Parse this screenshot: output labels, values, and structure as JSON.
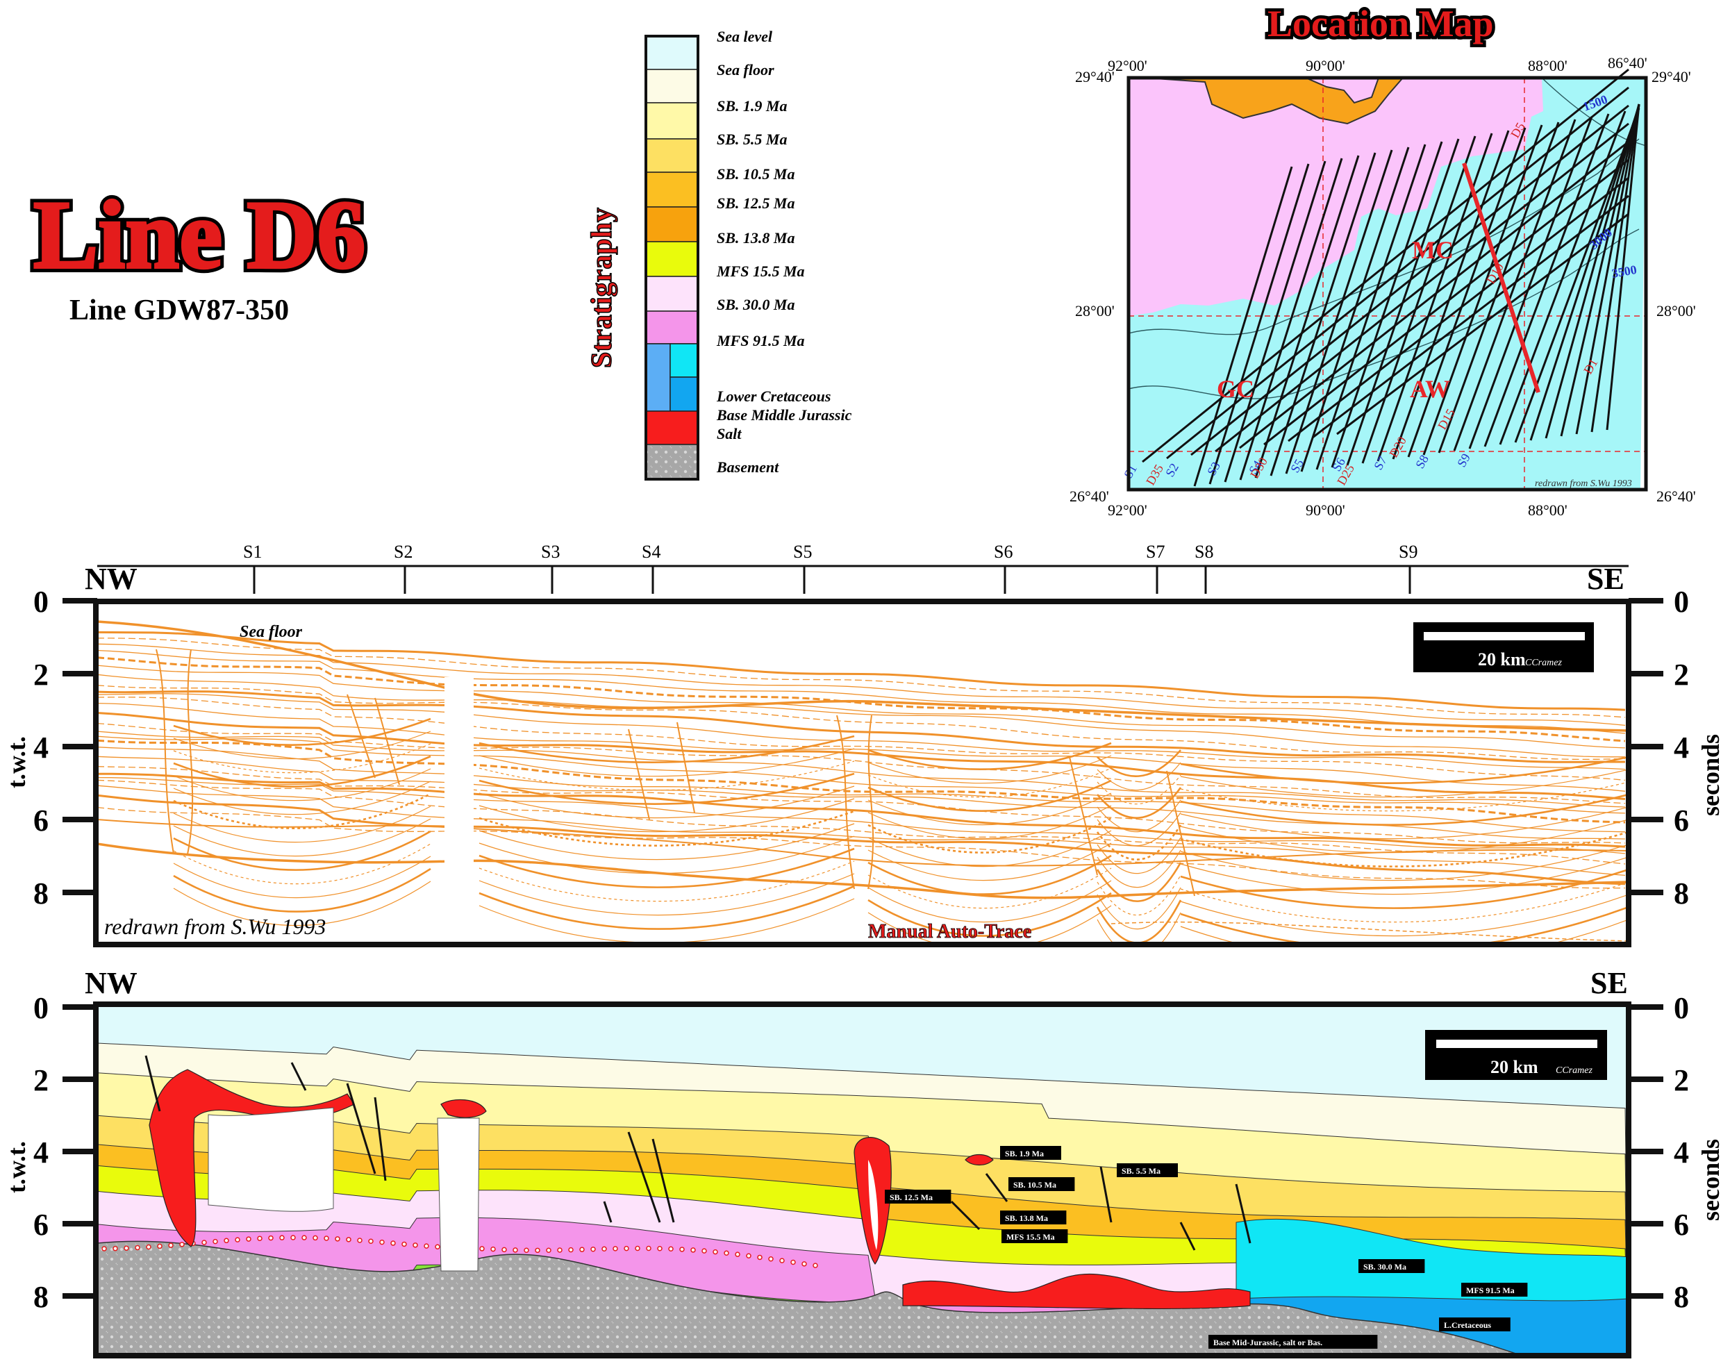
{
  "title": {
    "main": "Line D6",
    "sub": "Line GDW87-350"
  },
  "stratigraphy": {
    "heading": "Stratigraphy",
    "units": [
      {
        "label": "Sea level",
        "color": "#dffafc"
      },
      {
        "label": "Sea floor",
        "color": "#fdfbe6"
      },
      {
        "label": "SB. 1.9 Ma",
        "color": "#fff9a8"
      },
      {
        "label": "SB. 5.5 Ma",
        "color": "#fde062"
      },
      {
        "label": "SB. 10.5 Ma",
        "color": "#fbbf22"
      },
      {
        "label": "SB. 12.5 Ma",
        "color": "#f7a20d"
      },
      {
        "label": "SB. 13.8 Ma",
        "color": "#e9fb0c"
      },
      {
        "label": "MFS 15.5 Ma",
        "color": "#fde3fb"
      },
      {
        "label": "SB. 30.0 Ma",
        "color": "#f495ea"
      },
      {
        "label": "MFS 91.5 Ma",
        "color": "#86e23a"
      },
      {
        "label": "Lower Cretaceous",
        "color": "#5caef5"
      },
      {
        "label": "Base Middle Jurassic",
        "color": "#10e6f5"
      },
      {
        "label": "Salt",
        "color": "#f71d1d"
      },
      {
        "label": "Basement",
        "color": "#a8a8a8"
      }
    ]
  },
  "location_map": {
    "title": "Location Map",
    "corner_labels": {
      "top_left_lat": "29°40'",
      "top_right_lat": "29°40'",
      "bottom_left_lat": "26°40'",
      "bottom_right_lat": "26°40'",
      "top_left_lon": "92°00'",
      "top_lon_mid": "90°00'",
      "top_lon_right": "88°00'",
      "top_right_lon": "86°40'",
      "bottom_left_lon": "92°00'",
      "bottom_lon_mid": "90°00'",
      "bottom_lon_right": "88°00'",
      "left_mid_lat": "28°00'",
      "right_mid_lat": "28°00'"
    },
    "area_labels": [
      "GC",
      "MC",
      "AW"
    ],
    "dip_lines": [
      "D1",
      "D5",
      "D10",
      "D15",
      "D20",
      "D25",
      "D30",
      "D35"
    ],
    "strike_lines": [
      "S1",
      "S2",
      "S3",
      "S4",
      "S5",
      "S6",
      "S7",
      "S8",
      "S9"
    ],
    "contours": [
      "1500",
      "3000",
      "3500"
    ],
    "credit": "redrawn from S.Wu 1993",
    "land_color": "#fbc4fb",
    "sea_color": "#a6f6f8",
    "coast_color": "#f8a31b",
    "highlight_color": "#e8262a"
  },
  "sections": {
    "shotpoints": [
      "S1",
      "S2",
      "S3",
      "S4",
      "S5",
      "S6",
      "S7",
      "S8",
      "S9"
    ],
    "nw": "NW",
    "se": "SE",
    "y_ticks": [
      "0",
      "2",
      "4",
      "6",
      "8"
    ],
    "y_label_left": "t.w.t.",
    "y_label_right": "seconds",
    "scale_bar": "20 km",
    "scale_credit": "CCramez",
    "upper": {
      "sea_floor_label": "Sea floor",
      "credit": "redrawn from S.Wu 1993",
      "trace_label": "Manual Auto-Trace",
      "line_color": "#f0912a"
    },
    "lower": {
      "tags": [
        "SB. 1.9 Ma",
        "SB. 5.5 Ma",
        "SB. 10.5 Ma",
        "SB. 12.5 Ma",
        "SB. 13.8 Ma",
        "MFS 15.5 Ma",
        "SB. 30.0 Ma",
        "MFS 91.5 Ma",
        "L.Cretaceous",
        "Base Mid-Jurassic, salt or Bas."
      ]
    }
  }
}
